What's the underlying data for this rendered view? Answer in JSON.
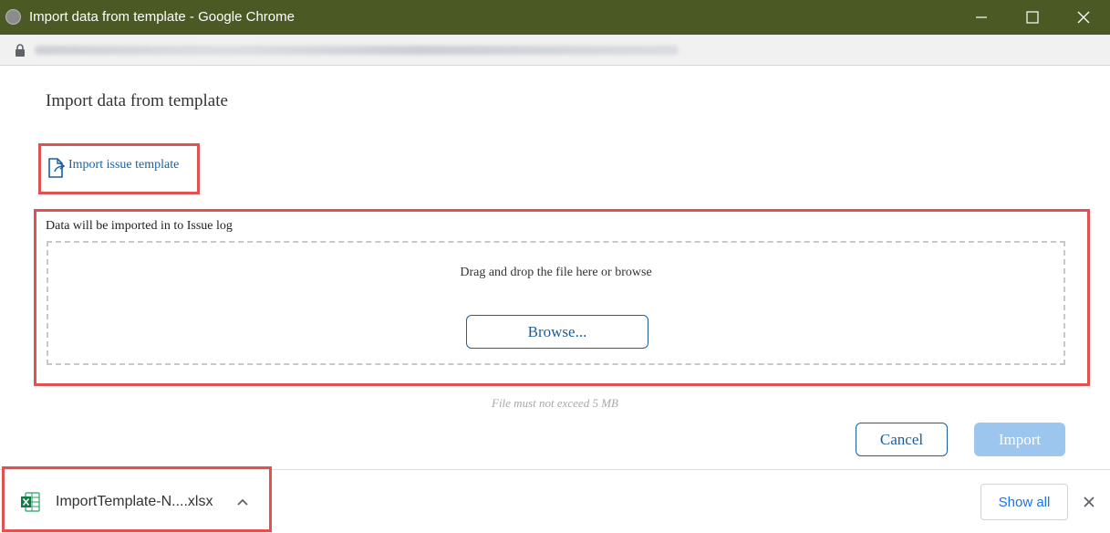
{
  "window": {
    "title": "Import data from template - Google Chrome"
  },
  "dialog": {
    "title": "Import data from template",
    "template_link": "Import issue template",
    "import_note": "Data will be imported in to Issue log",
    "dropzone_text": "Drag and drop the file here or browse",
    "browse_label": "Browse...",
    "size_note": "File must not exceed 5 MB",
    "cancel_label": "Cancel",
    "import_label": "Import"
  },
  "downloads": {
    "file_name": "ImportTemplate-N....xlsx",
    "show_all_label": "Show all"
  },
  "icons": {
    "globe": "globe-icon",
    "lock": "lock-icon",
    "template": "document-import-icon",
    "excel": "excel-file-icon"
  },
  "colors": {
    "titlebar": "#4b5a25",
    "link": "#1b5f9e",
    "highlight": "#e05252",
    "import_disabled": "#9cc6ee",
    "show_all": "#1a73e8"
  }
}
